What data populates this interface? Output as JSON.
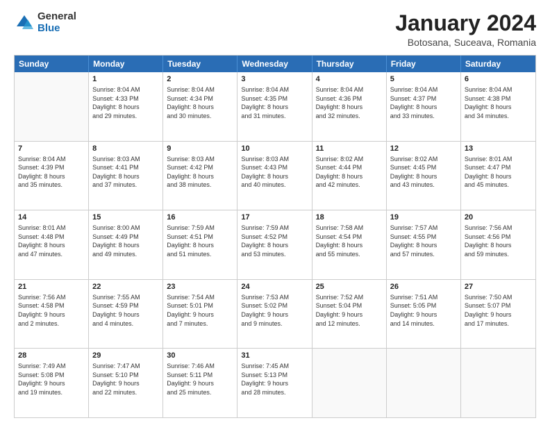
{
  "logo": {
    "general": "General",
    "blue": "Blue"
  },
  "title": "January 2024",
  "location": "Botosana, Suceava, Romania",
  "days_of_week": [
    "Sunday",
    "Monday",
    "Tuesday",
    "Wednesday",
    "Thursday",
    "Friday",
    "Saturday"
  ],
  "weeks": [
    [
      {
        "day": "",
        "lines": []
      },
      {
        "day": "1",
        "lines": [
          "Sunrise: 8:04 AM",
          "Sunset: 4:33 PM",
          "Daylight: 8 hours",
          "and 29 minutes."
        ]
      },
      {
        "day": "2",
        "lines": [
          "Sunrise: 8:04 AM",
          "Sunset: 4:34 PM",
          "Daylight: 8 hours",
          "and 30 minutes."
        ]
      },
      {
        "day": "3",
        "lines": [
          "Sunrise: 8:04 AM",
          "Sunset: 4:35 PM",
          "Daylight: 8 hours",
          "and 31 minutes."
        ]
      },
      {
        "day": "4",
        "lines": [
          "Sunrise: 8:04 AM",
          "Sunset: 4:36 PM",
          "Daylight: 8 hours",
          "and 32 minutes."
        ]
      },
      {
        "day": "5",
        "lines": [
          "Sunrise: 8:04 AM",
          "Sunset: 4:37 PM",
          "Daylight: 8 hours",
          "and 33 minutes."
        ]
      },
      {
        "day": "6",
        "lines": [
          "Sunrise: 8:04 AM",
          "Sunset: 4:38 PM",
          "Daylight: 8 hours",
          "and 34 minutes."
        ]
      }
    ],
    [
      {
        "day": "7",
        "lines": [
          "Sunrise: 8:04 AM",
          "Sunset: 4:39 PM",
          "Daylight: 8 hours",
          "and 35 minutes."
        ]
      },
      {
        "day": "8",
        "lines": [
          "Sunrise: 8:03 AM",
          "Sunset: 4:41 PM",
          "Daylight: 8 hours",
          "and 37 minutes."
        ]
      },
      {
        "day": "9",
        "lines": [
          "Sunrise: 8:03 AM",
          "Sunset: 4:42 PM",
          "Daylight: 8 hours",
          "and 38 minutes."
        ]
      },
      {
        "day": "10",
        "lines": [
          "Sunrise: 8:03 AM",
          "Sunset: 4:43 PM",
          "Daylight: 8 hours",
          "and 40 minutes."
        ]
      },
      {
        "day": "11",
        "lines": [
          "Sunrise: 8:02 AM",
          "Sunset: 4:44 PM",
          "Daylight: 8 hours",
          "and 42 minutes."
        ]
      },
      {
        "day": "12",
        "lines": [
          "Sunrise: 8:02 AM",
          "Sunset: 4:45 PM",
          "Daylight: 8 hours",
          "and 43 minutes."
        ]
      },
      {
        "day": "13",
        "lines": [
          "Sunrise: 8:01 AM",
          "Sunset: 4:47 PM",
          "Daylight: 8 hours",
          "and 45 minutes."
        ]
      }
    ],
    [
      {
        "day": "14",
        "lines": [
          "Sunrise: 8:01 AM",
          "Sunset: 4:48 PM",
          "Daylight: 8 hours",
          "and 47 minutes."
        ]
      },
      {
        "day": "15",
        "lines": [
          "Sunrise: 8:00 AM",
          "Sunset: 4:49 PM",
          "Daylight: 8 hours",
          "and 49 minutes."
        ]
      },
      {
        "day": "16",
        "lines": [
          "Sunrise: 7:59 AM",
          "Sunset: 4:51 PM",
          "Daylight: 8 hours",
          "and 51 minutes."
        ]
      },
      {
        "day": "17",
        "lines": [
          "Sunrise: 7:59 AM",
          "Sunset: 4:52 PM",
          "Daylight: 8 hours",
          "and 53 minutes."
        ]
      },
      {
        "day": "18",
        "lines": [
          "Sunrise: 7:58 AM",
          "Sunset: 4:54 PM",
          "Daylight: 8 hours",
          "and 55 minutes."
        ]
      },
      {
        "day": "19",
        "lines": [
          "Sunrise: 7:57 AM",
          "Sunset: 4:55 PM",
          "Daylight: 8 hours",
          "and 57 minutes."
        ]
      },
      {
        "day": "20",
        "lines": [
          "Sunrise: 7:56 AM",
          "Sunset: 4:56 PM",
          "Daylight: 8 hours",
          "and 59 minutes."
        ]
      }
    ],
    [
      {
        "day": "21",
        "lines": [
          "Sunrise: 7:56 AM",
          "Sunset: 4:58 PM",
          "Daylight: 9 hours",
          "and 2 minutes."
        ]
      },
      {
        "day": "22",
        "lines": [
          "Sunrise: 7:55 AM",
          "Sunset: 4:59 PM",
          "Daylight: 9 hours",
          "and 4 minutes."
        ]
      },
      {
        "day": "23",
        "lines": [
          "Sunrise: 7:54 AM",
          "Sunset: 5:01 PM",
          "Daylight: 9 hours",
          "and 7 minutes."
        ]
      },
      {
        "day": "24",
        "lines": [
          "Sunrise: 7:53 AM",
          "Sunset: 5:02 PM",
          "Daylight: 9 hours",
          "and 9 minutes."
        ]
      },
      {
        "day": "25",
        "lines": [
          "Sunrise: 7:52 AM",
          "Sunset: 5:04 PM",
          "Daylight: 9 hours",
          "and 12 minutes."
        ]
      },
      {
        "day": "26",
        "lines": [
          "Sunrise: 7:51 AM",
          "Sunset: 5:05 PM",
          "Daylight: 9 hours",
          "and 14 minutes."
        ]
      },
      {
        "day": "27",
        "lines": [
          "Sunrise: 7:50 AM",
          "Sunset: 5:07 PM",
          "Daylight: 9 hours",
          "and 17 minutes."
        ]
      }
    ],
    [
      {
        "day": "28",
        "lines": [
          "Sunrise: 7:49 AM",
          "Sunset: 5:08 PM",
          "Daylight: 9 hours",
          "and 19 minutes."
        ]
      },
      {
        "day": "29",
        "lines": [
          "Sunrise: 7:47 AM",
          "Sunset: 5:10 PM",
          "Daylight: 9 hours",
          "and 22 minutes."
        ]
      },
      {
        "day": "30",
        "lines": [
          "Sunrise: 7:46 AM",
          "Sunset: 5:11 PM",
          "Daylight: 9 hours",
          "and 25 minutes."
        ]
      },
      {
        "day": "31",
        "lines": [
          "Sunrise: 7:45 AM",
          "Sunset: 5:13 PM",
          "Daylight: 9 hours",
          "and 28 minutes."
        ]
      },
      {
        "day": "",
        "lines": []
      },
      {
        "day": "",
        "lines": []
      },
      {
        "day": "",
        "lines": []
      }
    ]
  ]
}
